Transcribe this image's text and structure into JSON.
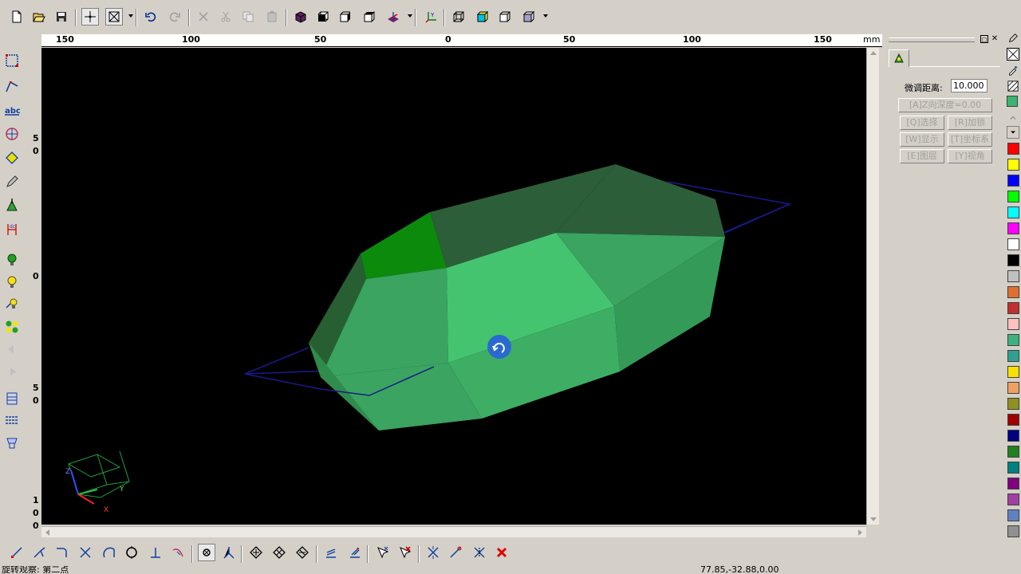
{
  "ruler": {
    "unit": "mm",
    "labels": [
      "150",
      "100",
      "50",
      "0",
      "50",
      "100",
      "150"
    ]
  },
  "vertical_ruler": {
    "labels": [
      "5",
      "0",
      "0",
      "5",
      "0",
      "1",
      "0",
      "0"
    ]
  },
  "right_panel": {
    "fine_tune_label": "微调距离:",
    "fine_tune_value": "10.000",
    "z_depth_button": "[A]Z向深度=0.00",
    "buttons": [
      "[Q]选择",
      "[R]加锁",
      "[W]显示",
      "[T]坐标系",
      "[E]图层",
      "[Y]视角"
    ]
  },
  "palette": {
    "colors": [
      "#3cb371",
      "#ff0000",
      "#ffff00",
      "#0000ff",
      "#00ff00",
      "#00ffff",
      "#ff00ff",
      "#ffffff",
      "#000000",
      "#c0c0c0",
      "#e07030",
      "#c03030",
      "#ffc0c0",
      "#40b080",
      "#30a090",
      "#f8e000",
      "#f0a060",
      "#909020",
      "#a00000",
      "#000080",
      "#208020",
      "#008080",
      "#800080",
      "#a040a0",
      "#6080c0",
      "#909090"
    ]
  },
  "status": {
    "message": "旋转观察: 第二点",
    "coords": "77.85,-32.88,0.00"
  },
  "scene": {
    "mesh_color": "#3cb371",
    "background": "#000000",
    "axis_labels": [
      "Z",
      "Y",
      "X"
    ]
  }
}
